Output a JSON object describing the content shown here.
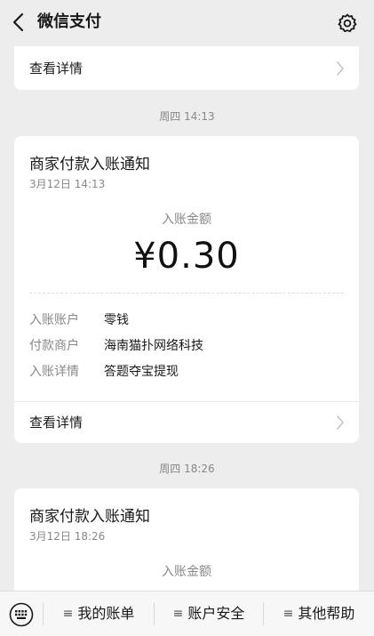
{
  "header": {
    "title": "微信支付"
  },
  "messages": [
    {
      "detail_label": "查看详情"
    },
    {
      "time": "周四 14:13",
      "title": "商家付款入账通知",
      "date": "3月12日 14:13",
      "amount_label": "入账金额",
      "amount": "¥0.30",
      "info": [
        {
          "key": "入账账户",
          "value": "零钱"
        },
        {
          "key": "付款商户",
          "value": "海南猫扑网络科技"
        },
        {
          "key": "入账详情",
          "value": "答题夺宝提现"
        }
      ],
      "detail_label": "查看详情"
    },
    {
      "time": "周四 18:26",
      "title": "商家付款入账通知",
      "date": "3月12日 18:26",
      "amount_label": "入账金额"
    }
  ],
  "bottom_menu": [
    {
      "label": "我的账单"
    },
    {
      "label": "账户安全"
    },
    {
      "label": "其他帮助"
    }
  ]
}
